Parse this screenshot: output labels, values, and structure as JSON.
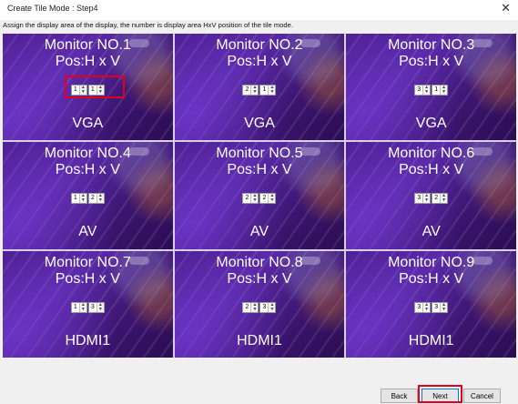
{
  "window": {
    "title": "Create Tile Mode : Step4",
    "close_glyph": "✕"
  },
  "instruction": "Assign the display area of the display, the number is display area HxV position of the tile mode.",
  "tiles": [
    {
      "name": "Monitor NO.1",
      "pos": "Pos:H x V",
      "h": "1",
      "v": "1",
      "source": "VGA"
    },
    {
      "name": "Monitor NO.2",
      "pos": "Pos:H x V",
      "h": "2",
      "v": "1",
      "source": "VGA"
    },
    {
      "name": "Monitor NO.3",
      "pos": "Pos:H x V",
      "h": "3",
      "v": "1",
      "source": "VGA"
    },
    {
      "name": "Monitor NO.4",
      "pos": "Pos:H x V",
      "h": "1",
      "v": "2",
      "source": "AV"
    },
    {
      "name": "Monitor NO.5",
      "pos": "Pos:H x V",
      "h": "2",
      "v": "2",
      "source": "AV"
    },
    {
      "name": "Monitor NO.6",
      "pos": "Pos:H x V",
      "h": "3",
      "v": "2",
      "source": "AV"
    },
    {
      "name": "Monitor NO.7",
      "pos": "Pos:H x V",
      "h": "1",
      "v": "3",
      "source": "HDMI1"
    },
    {
      "name": "Monitor NO.8",
      "pos": "Pos:H x V",
      "h": "2",
      "v": "3",
      "source": "HDMI1"
    },
    {
      "name": "Monitor NO.9",
      "pos": "Pos:H x V",
      "h": "3",
      "v": "3",
      "source": "HDMI1"
    }
  ],
  "buttons": {
    "back": "Back",
    "next": "Next",
    "cancel": "Cancel"
  },
  "colors": {
    "highlight": "#e0001b",
    "tile_purple": "#4b1d8e"
  }
}
